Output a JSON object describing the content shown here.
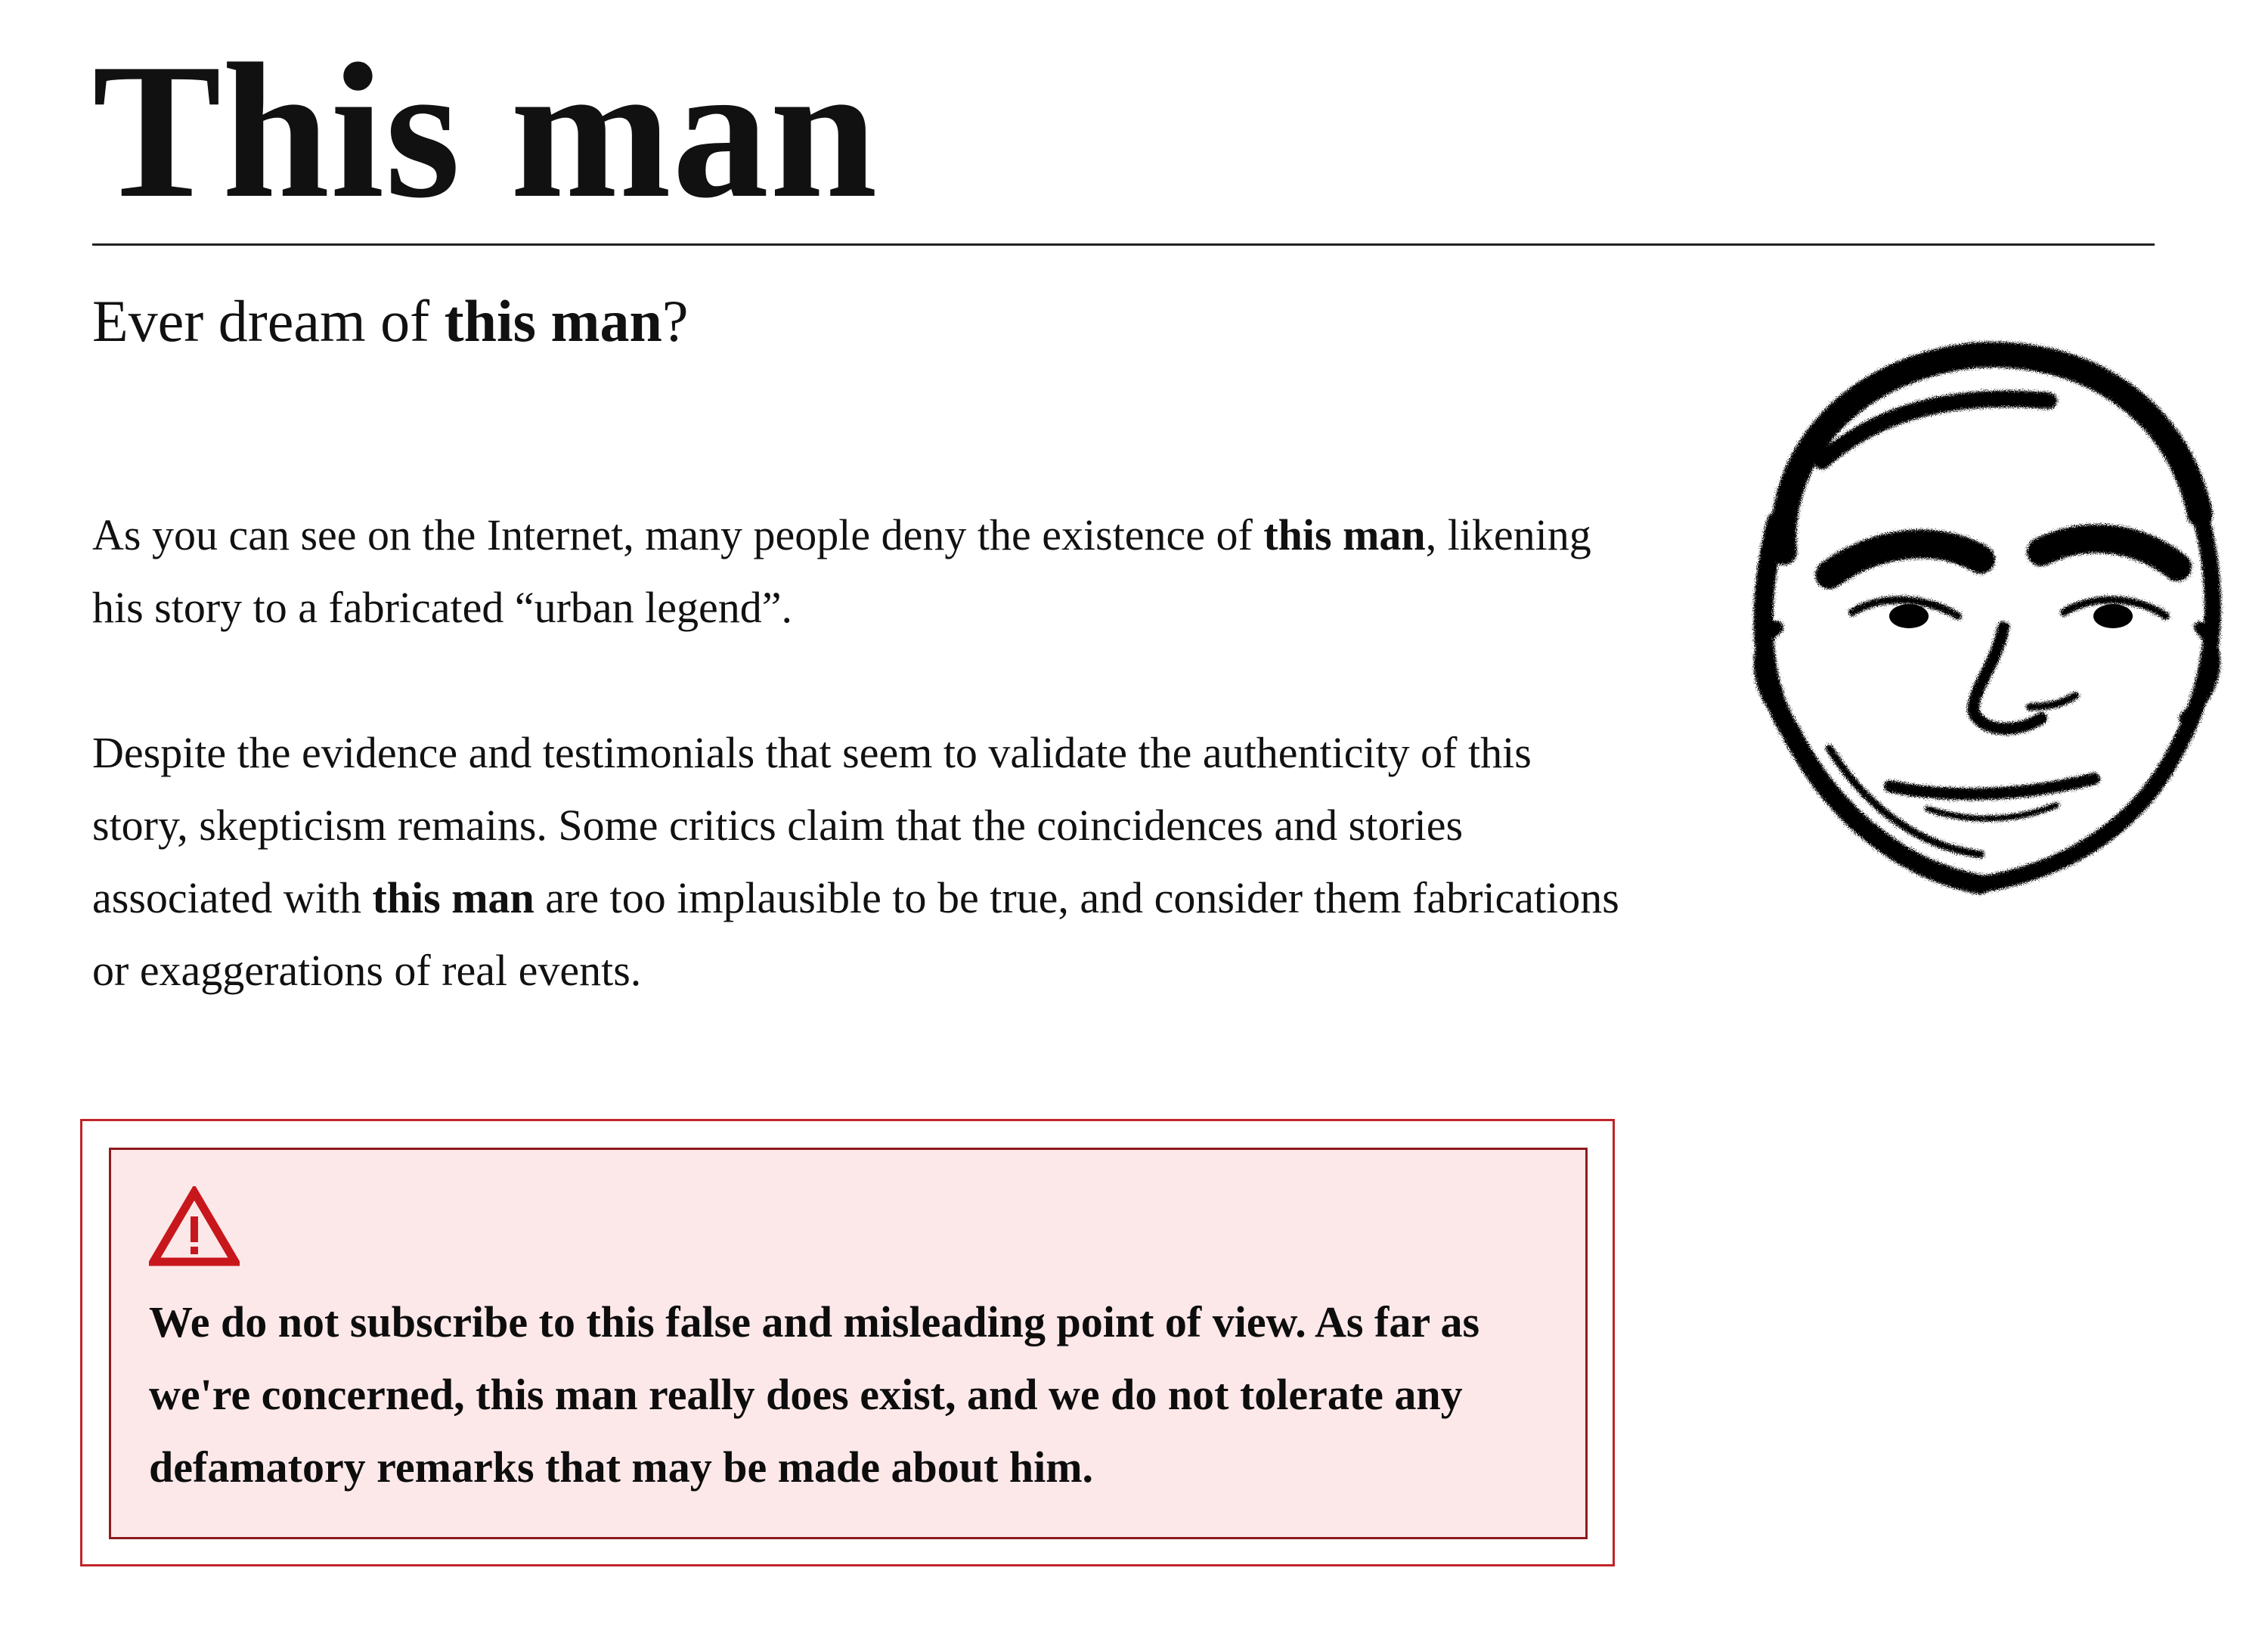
{
  "page": {
    "title": "This man"
  },
  "subtitle": {
    "before": "Ever dream of ",
    "bold": "this man",
    "after": "?"
  },
  "paragraph_1": {
    "before": "As you can see on the Internet, many people deny the existence of ",
    "bold": "this man",
    "after": ", likening his story to a fabricated “urban legend”."
  },
  "paragraph_2": {
    "before": "Despite the evidence and testimonials that seem to validate the authenticity of this story, skepticism remains. Some critics claim that the coincidences and stories associated with ",
    "bold": "this man",
    "after": " are too implausible to be true, and consider them fabrications or exaggerations of real events."
  },
  "notice": {
    "icon": "warning-triangle-icon",
    "text": "We do not subscribe to this false and misleading point of view. As far as we're concerned, this man really does exist, and we do not tolerate any defamatory remarks that may be made about him."
  },
  "image": {
    "icon": "face-sketch-icon"
  },
  "colors": {
    "notice_border": "#c0252a",
    "notice_background": "#fde8e9",
    "warning_icon": "#c8171c"
  }
}
